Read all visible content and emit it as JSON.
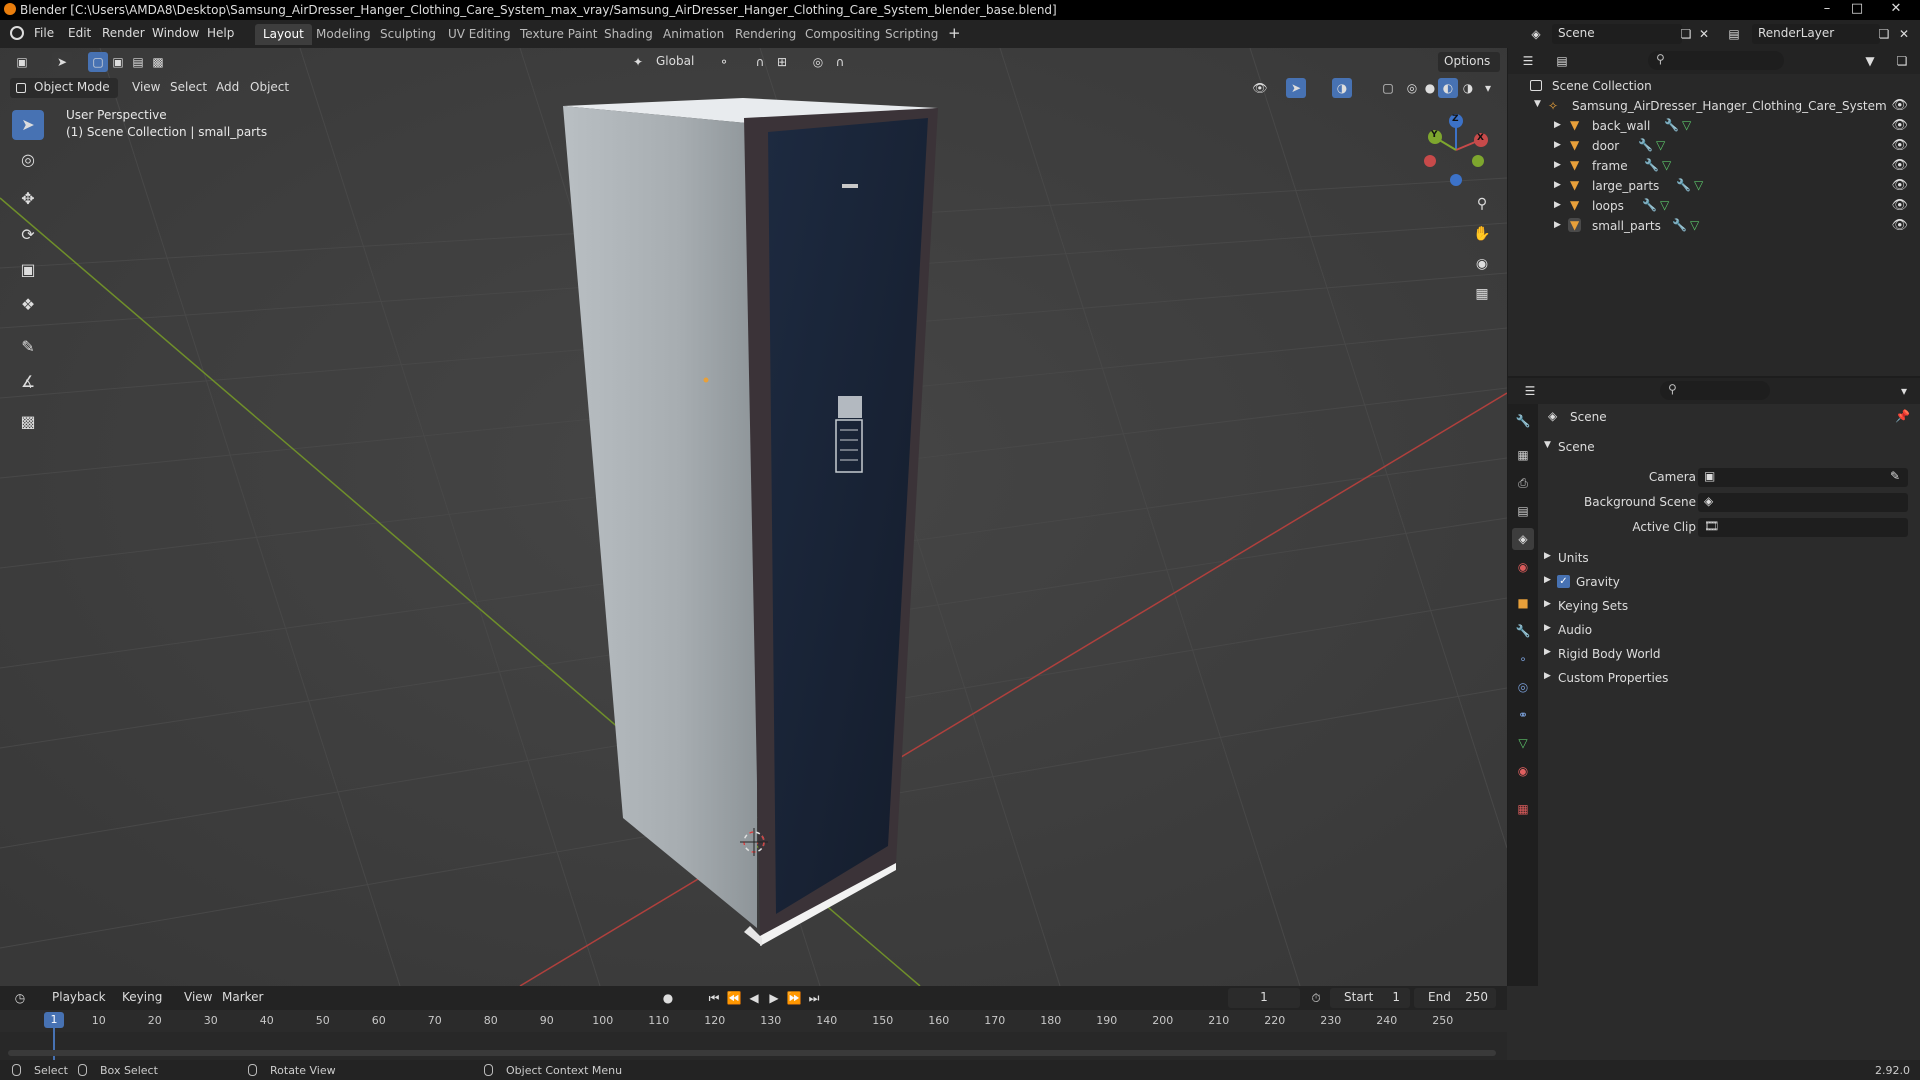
{
  "titlebar": {
    "title": "Blender [C:\\Users\\AMDA8\\Desktop\\Samsung_AirDresser_Hanger_Clothing_Care_System_max_vray/Samsung_AirDresser_Hanger_Clothing_Care_System_blender_base.blend]"
  },
  "menus": [
    "File",
    "Edit",
    "Render",
    "Window",
    "Help"
  ],
  "workspaces": [
    "Layout",
    "Modeling",
    "Sculpting",
    "UV Editing",
    "Texture Paint",
    "Shading",
    "Animation",
    "Rendering",
    "Compositing",
    "Scripting"
  ],
  "active_workspace": "Layout",
  "scene_selector": {
    "value": "Scene"
  },
  "renderlayer_selector": {
    "value": "RenderLayer"
  },
  "viewport": {
    "transform_orientation": "Global",
    "options_label": "Options",
    "mode": "Object Mode",
    "menu": [
      "View",
      "Select",
      "Add",
      "Object"
    ],
    "overlay_line1": "User Perspective",
    "overlay_line2": "(1) Scene Collection | small_parts",
    "gizmo": {
      "x": "X",
      "y": "Y",
      "z": "Z"
    }
  },
  "outliner": {
    "root": "Scene Collection",
    "collection": "Samsung_AirDresser_Hanger_Clothing_Care_System",
    "objects": [
      "back_wall",
      "door",
      "frame",
      "large_parts",
      "loops",
      "small_parts"
    ]
  },
  "properties": {
    "context_title": "Scene",
    "panel_title": "Scene",
    "fields": {
      "camera_label": "Camera",
      "background_scene_label": "Background Scene",
      "active_clip_label": "Active Clip"
    },
    "subpanels": [
      "Units",
      "Gravity",
      "Keying Sets",
      "Audio",
      "Rigid Body World",
      "Custom Properties"
    ],
    "gravity_checked": true
  },
  "timeline": {
    "menu": [
      "Playback",
      "Keying",
      "View",
      "Marker"
    ],
    "current_frame": "1",
    "start_label": "Start",
    "start_value": "1",
    "end_label": "End",
    "end_value": "250",
    "ruler": [
      "1",
      "10",
      "20",
      "30",
      "40",
      "50",
      "60",
      "70",
      "80",
      "90",
      "100",
      "110",
      "120",
      "130",
      "140",
      "150",
      "160",
      "170",
      "180",
      "190",
      "200",
      "210",
      "220",
      "230",
      "240",
      "250"
    ]
  },
  "statusbar": {
    "select": "Select",
    "box_select": "Box Select",
    "rotate_view": "Rotate View",
    "context_menu": "Object Context Menu",
    "version": "2.92.0"
  },
  "colors": {
    "accent_blue": "#4772b3",
    "axis_red": "#c0423f",
    "axis_green": "#7c9a2a",
    "door_navy": "#1a2336"
  }
}
